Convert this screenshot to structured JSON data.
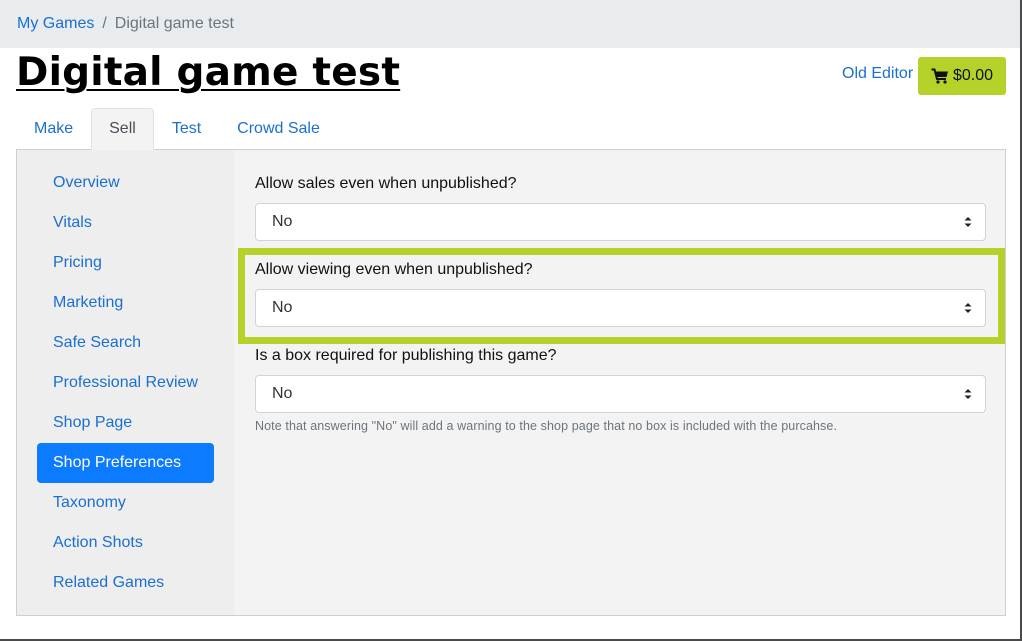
{
  "breadcrumb": {
    "root": "My Games",
    "separator": "/",
    "current": "Digital game test"
  },
  "header": {
    "title": "Digital game test",
    "old_editor": "Old Editor",
    "cart_total": "$0.00",
    "cart_icon": "shopping-cart-icon",
    "accent_color": "#b5d22a"
  },
  "tabs": [
    {
      "label": "Make",
      "active": false
    },
    {
      "label": "Sell",
      "active": true
    },
    {
      "label": "Test",
      "active": false
    },
    {
      "label": "Crowd Sale",
      "active": false
    }
  ],
  "sidebar": {
    "items": [
      {
        "label": "Overview",
        "active": false
      },
      {
        "label": "Vitals",
        "active": false
      },
      {
        "label": "Pricing",
        "active": false
      },
      {
        "label": "Marketing",
        "active": false
      },
      {
        "label": "Safe Search",
        "active": false
      },
      {
        "label": "Professional Review",
        "active": false
      },
      {
        "label": "Shop Page",
        "active": false
      },
      {
        "label": "Shop Preferences",
        "active": true
      },
      {
        "label": "Taxonomy",
        "active": false
      },
      {
        "label": "Action Shots",
        "active": false
      },
      {
        "label": "Related Games",
        "active": false
      }
    ],
    "active_color": "#0d7bff"
  },
  "form": {
    "fields": [
      {
        "label": "Allow sales even when unpublished?",
        "value": "No",
        "highlighted": false
      },
      {
        "label": "Allow viewing even when unpublished?",
        "value": "No",
        "highlighted": true
      },
      {
        "label": "Is a box required for publishing this game?",
        "value": "No",
        "highlighted": false
      }
    ],
    "help_text": "Note that answering \"No\" will add a warning to the shop page that no box is included with the purcahse."
  }
}
